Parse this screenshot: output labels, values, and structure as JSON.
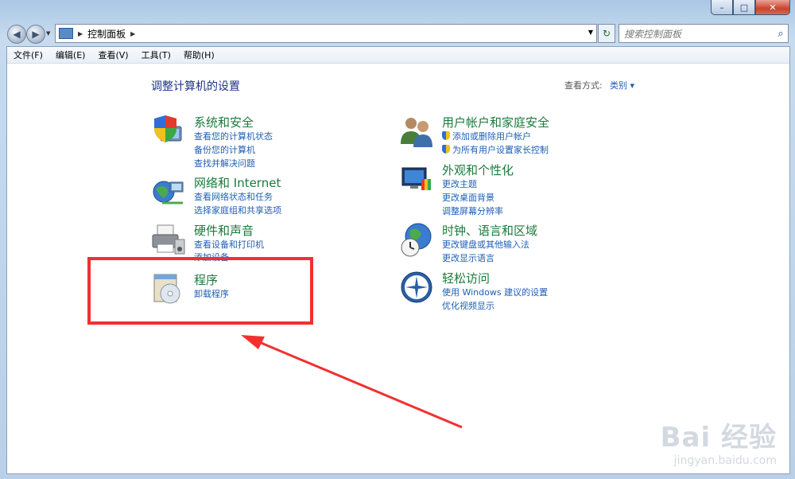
{
  "window": {
    "controls": {
      "minimize": "–",
      "maximize": "□",
      "close": "✕"
    }
  },
  "navigation": {
    "back_icon": "back-arrow-icon",
    "forward_icon": "forward-arrow-icon",
    "breadcrumb": [
      "控制面板"
    ],
    "search_placeholder": "搜索控制面板"
  },
  "menu": [
    "文件(F)",
    "编辑(E)",
    "查看(V)",
    "工具(T)",
    "帮助(H)"
  ],
  "page": {
    "title": "调整计算机的设置",
    "view_by_label": "查看方式:",
    "view_by_value": "类别 ▾"
  },
  "categories_left": [
    {
      "title": "系统和安全",
      "icon": "shield-pc-icon",
      "links": [
        "查看您的计算机状态",
        "备份您的计算机",
        "查找并解决问题"
      ]
    },
    {
      "title": "网络和 Internet",
      "icon": "network-globe-icon",
      "links": [
        "查看网络状态和任务",
        "选择家庭组和共享选项"
      ]
    },
    {
      "title": "硬件和声音",
      "icon": "printer-icon",
      "links": [
        "查看设备和打印机",
        "添加设备"
      ]
    },
    {
      "title": "程序",
      "icon": "programs-disc-icon",
      "links": [
        "卸载程序"
      ]
    }
  ],
  "categories_right": [
    {
      "title": "用户帐户和家庭安全",
      "icon": "users-icon",
      "links": [
        "添加或删除用户帐户",
        "为所有用户设置家长控制"
      ]
    },
    {
      "title": "外观和个性化",
      "icon": "monitor-paint-icon",
      "links": [
        "更改主题",
        "更改桌面背景",
        "调整屏幕分辨率"
      ]
    },
    {
      "title": "时钟、语言和区域",
      "icon": "globe-clock-icon",
      "links": [
        "更改键盘或其他输入法",
        "更改显示语言"
      ]
    },
    {
      "title": "轻松访问",
      "icon": "ease-of-access-icon",
      "links": [
        "使用 Windows 建议的设置",
        "优化视频显示"
      ]
    }
  ],
  "annotation": {
    "highlight_color": "#f23030"
  },
  "watermark": {
    "brand": "Bai 经验",
    "url": "jingyan.baidu.com"
  }
}
